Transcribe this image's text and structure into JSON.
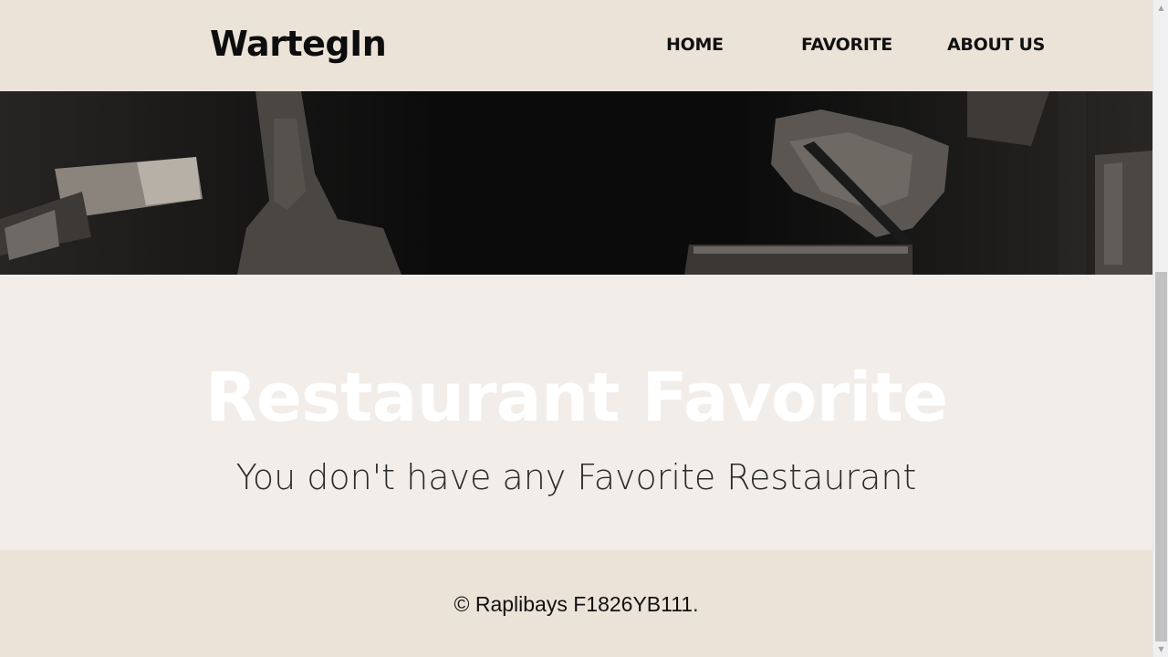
{
  "header": {
    "brand": "WartegIn",
    "nav": [
      {
        "label": "HOME"
      },
      {
        "label": "FAVORITE"
      },
      {
        "label": "ABOUT US"
      }
    ]
  },
  "hero": {
    "image": "hands-cooking-photo"
  },
  "main": {
    "title": "Restaurant Favorite",
    "empty_message": "You don't have any Favorite Restaurant"
  },
  "footer": {
    "copyright": "© Raplibays F1826YB111."
  },
  "colors": {
    "header_bg": "#ebe3d8",
    "main_bg": "#f2ede8",
    "hero_bg": "#0c0c0c",
    "title": "#ffffff",
    "text": "#111111"
  }
}
